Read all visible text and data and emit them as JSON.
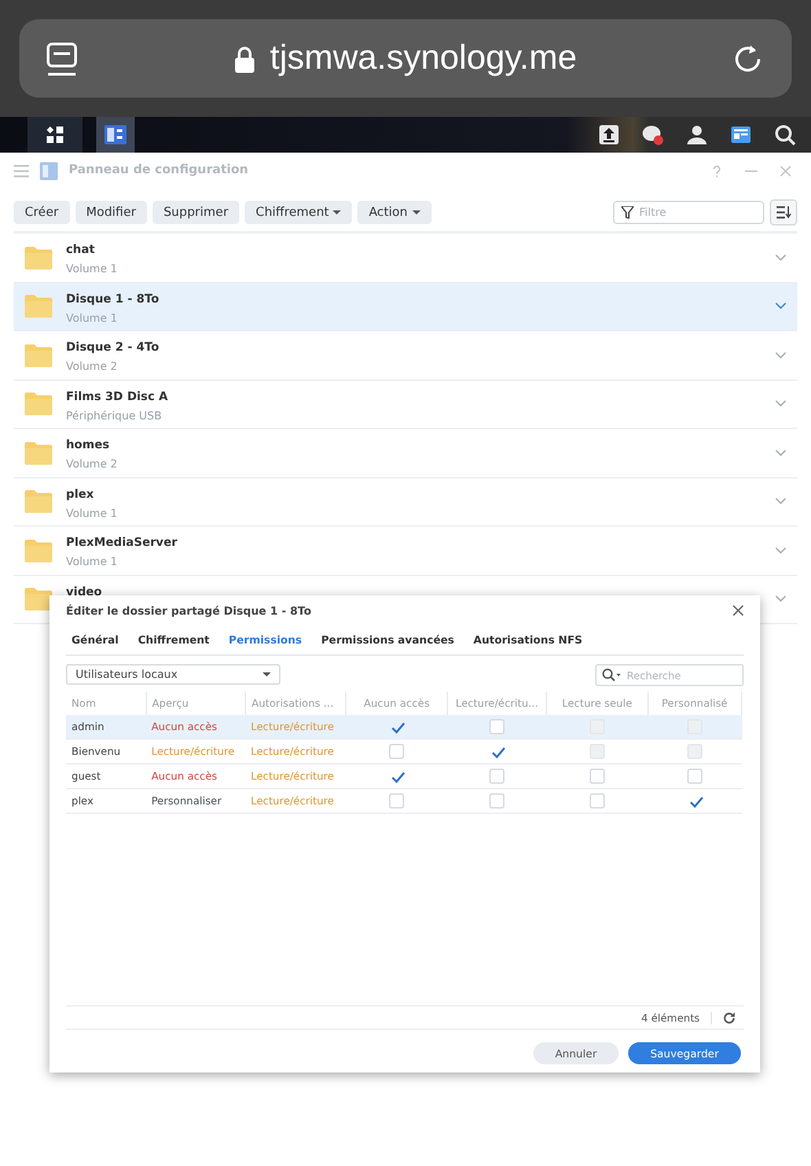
{
  "browser": {
    "url": "tjsmwa.synology.me"
  },
  "window": {
    "title": "Panneau de configuration"
  },
  "toolbar": {
    "buttons": [
      {
        "label": "Créer",
        "menu": false
      },
      {
        "label": "Modifier",
        "menu": false
      },
      {
        "label": "Supprimer",
        "menu": false
      },
      {
        "label": "Chiffrement",
        "menu": true
      },
      {
        "label": "Action",
        "menu": true
      }
    ],
    "filter": {
      "placeholder": "Filtre"
    }
  },
  "folders": [
    {
      "name": "chat",
      "location": "Volume 1",
      "selected": false
    },
    {
      "name": "Disque 1 - 8To",
      "location": "Volume 1",
      "selected": true
    },
    {
      "name": "Disque 2 - 4To",
      "location": "Volume 2",
      "selected": false
    },
    {
      "name": "Films 3D Disc A",
      "location": "Périphérique USB",
      "selected": false
    },
    {
      "name": "homes",
      "location": "Volume 2",
      "selected": false
    },
    {
      "name": "plex",
      "location": "Volume 1",
      "selected": false
    },
    {
      "name": "PlexMediaServer",
      "location": "Volume 1",
      "selected": false
    },
    {
      "name": "video",
      "selected": false
    }
  ],
  "dialog": {
    "title": "Éditer le dossier partagé Disque 1 - 8To",
    "tabs": [
      {
        "label": "Général",
        "selected": false
      },
      {
        "label": "Chiffrement",
        "selected": false
      },
      {
        "label": "Permissions",
        "selected": true
      },
      {
        "label": "Permissions avancées",
        "selected": false
      },
      {
        "label": "Autorisations NFS",
        "selected": false
      }
    ],
    "user_type": "Utilisateurs locaux",
    "search": {
      "placeholder": "Recherche"
    },
    "columns": [
      "Nom",
      "Aperçu",
      "Autorisations ...",
      "Aucun accès",
      "Lecture/écritu...",
      "Lecture seule",
      "Personnalisé"
    ],
    "rows": [
      {
        "name": "admin",
        "preview": {
          "text": "Aucun accès",
          "kind": "deny"
        },
        "group": {
          "text": "Lecture/écriture",
          "kind": "readwrite"
        },
        "selected": true,
        "perms": [
          {
            "checked": true,
            "disabled": false
          },
          {
            "checked": false,
            "disabled": false
          },
          {
            "checked": false,
            "disabled": true
          },
          {
            "checked": false,
            "disabled": true
          }
        ]
      },
      {
        "name": "Bienvenu",
        "preview": {
          "text": "Lecture/écriture",
          "kind": "readwrite"
        },
        "group": {
          "text": "Lecture/écriture",
          "kind": "readwrite"
        },
        "selected": false,
        "perms": [
          {
            "checked": false,
            "disabled": false
          },
          {
            "checked": true,
            "disabled": false
          },
          {
            "checked": false,
            "disabled": true
          },
          {
            "checked": false,
            "disabled": true
          }
        ]
      },
      {
        "name": "guest",
        "preview": {
          "text": "Aucun accès",
          "kind": "deny"
        },
        "group": {
          "text": "Lecture/écriture",
          "kind": "readwrite"
        },
        "selected": false,
        "perms": [
          {
            "checked": true,
            "disabled": false
          },
          {
            "checked": false,
            "disabled": false
          },
          {
            "checked": false,
            "disabled": false
          },
          {
            "checked": false,
            "disabled": false
          }
        ]
      },
      {
        "name": "plex",
        "preview": {
          "text": "Personnaliser",
          "kind": "custom"
        },
        "group": {
          "text": "Lecture/écriture",
          "kind": "readwrite"
        },
        "selected": false,
        "perms": [
          {
            "checked": false,
            "disabled": false
          },
          {
            "checked": false,
            "disabled": false
          },
          {
            "checked": false,
            "disabled": false
          },
          {
            "checked": true,
            "disabled": false
          }
        ]
      }
    ],
    "count": "4 éléments",
    "buttons": [
      {
        "label": "Annuler",
        "kind": "secondary"
      },
      {
        "label": "Sauvegarder",
        "kind": "primary"
      }
    ]
  }
}
